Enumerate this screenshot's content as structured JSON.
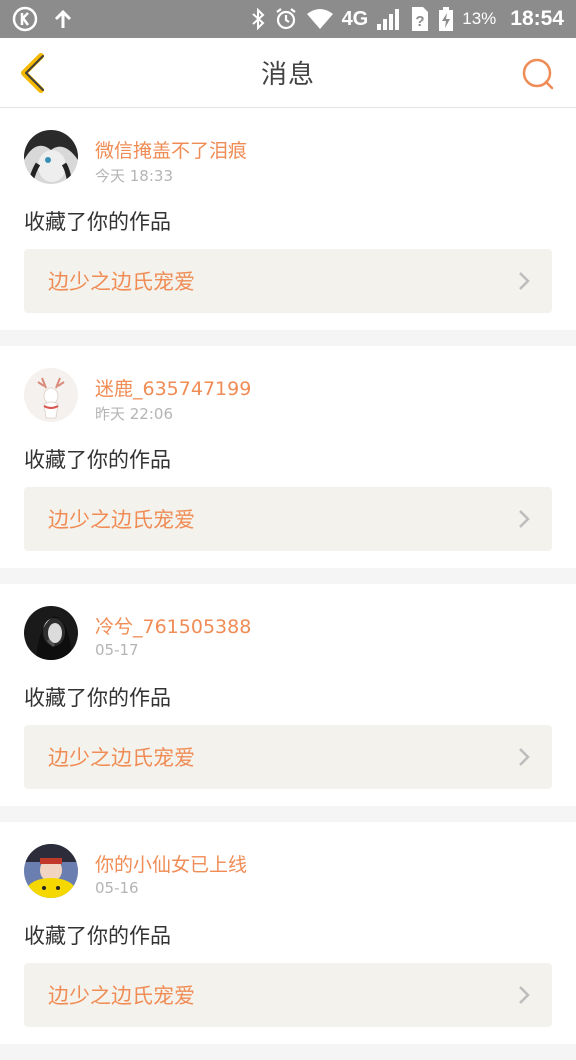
{
  "status_bar": {
    "network": "4G",
    "battery": "13%",
    "time": "18:54"
  },
  "header": {
    "title": "消息"
  },
  "messages": [
    {
      "user": "微信掩盖不了泪痕",
      "time": "今天 18:33",
      "action": "收藏了你的作品",
      "work_title": "边少之边氏宠爱"
    },
    {
      "user": "迷鹿_635747199",
      "time": "昨天 22:06",
      "action": "收藏了你的作品",
      "work_title": "边少之边氏宠爱"
    },
    {
      "user": "冷兮_761505388",
      "time": "05-17",
      "action": "收藏了你的作品",
      "work_title": "边少之边氏宠爱"
    },
    {
      "user": "你的小仙女已上线",
      "time": "05-16",
      "action": "收藏了你的作品",
      "work_title": "边少之边氏宠爱"
    }
  ],
  "colors": {
    "accent": "#f08c55",
    "back_arrow": "#f5b800",
    "card_link_bg": "#f4f2ec"
  }
}
